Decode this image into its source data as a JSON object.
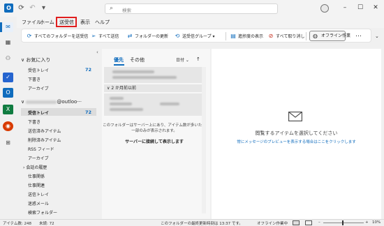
{
  "titlebar": {
    "app_icon": "outlook-logo",
    "search_placeholder": "検索",
    "window_controls": [
      "minimize-icon",
      "maximize-icon",
      "close-icon"
    ]
  },
  "menu": {
    "items": [
      "ファイル",
      "ホーム",
      "送受信",
      "表示",
      "ヘルプ"
    ],
    "highlighted": "送受信",
    "highlight_color": "#e01e1e"
  },
  "ribbon": {
    "send_receive_all": "すべてのフォルダーを送受信",
    "send_all": "すべて送信",
    "update_folder": "フォルダーの更新",
    "send_receive_groups": "送受信グループ",
    "show_progress": "進捗度の表示",
    "cancel_all": "すべて取り消し",
    "work_offline": "オフライン作業",
    "more": "…"
  },
  "folders": {
    "favorites_header": "お気に入り",
    "favorites": [
      {
        "label": "受信トレイ",
        "count": "72"
      },
      {
        "label": "下書き",
        "count": ""
      },
      {
        "label": "アーカイブ",
        "count": ""
      }
    ],
    "account_label": "@outloo···",
    "account_items": [
      {
        "label": "受信トレイ",
        "count": "72"
      },
      {
        "label": "下書き",
        "count": ""
      },
      {
        "label": "送信済みアイテム",
        "count": ""
      },
      {
        "label": "削除済みアイテム",
        "count": ""
      },
      {
        "label": "RSS フィード",
        "count": ""
      },
      {
        "label": "アーカイブ",
        "count": ""
      },
      {
        "label": "会話の履歴",
        "count": ""
      },
      {
        "label": "仕事関係",
        "count": ""
      },
      {
        "label": "仕事関連",
        "count": ""
      },
      {
        "label": "送信トレイ",
        "count": ""
      },
      {
        "label": "迷惑メール",
        "count": ""
      },
      {
        "label": "検索フォルダー",
        "count": ""
      }
    ]
  },
  "message_list": {
    "tab_focused": "優先",
    "tab_other": "その他",
    "sort_label": "日付",
    "group_header": "2 か月前以前",
    "server_notice": "このフォルダーはサーバー上にあり、アイテム数が多いため一部のみが表示されます。",
    "connect_link": "サーバーに接続して表示します"
  },
  "reading_pane": {
    "title": "閲覧するアイテムを選択してください",
    "link": "常にメッセージのプレビューを表示する場合はここをクリックします"
  },
  "status": {
    "item_count": "アイテム数: 248",
    "unread": "未読: 72",
    "last_update": "このフォルダーの最終更新時刻は 13:37 です。",
    "offline": "オフライン作業中",
    "zoom": "10%"
  },
  "colors": {
    "accent": "#0f6cbd",
    "unread_count": "#0f6cbd"
  }
}
